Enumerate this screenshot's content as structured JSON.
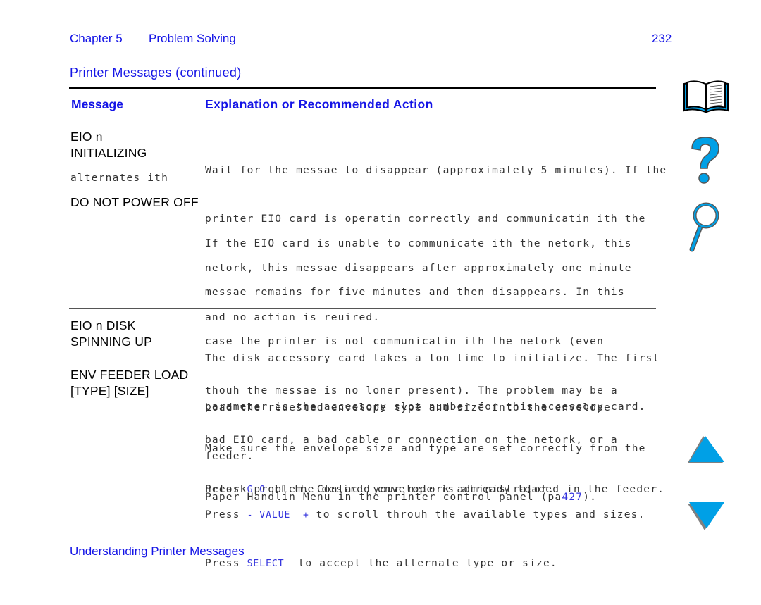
{
  "header": {
    "chapter": "Chapter 5",
    "section": "Problem Solving",
    "page_number": "232"
  },
  "subtitle": "Printer Messages (continued)",
  "table": {
    "columns": [
      "Message",
      "Explanation or Recommended Action"
    ],
    "rows": [
      {
        "message_lines": [
          "EIO n",
          "INITIALIZING"
        ],
        "alternates_label": "alternates ith",
        "message_alt": "DO NOT POWER OFF",
        "paragraphs": [
          [
            "Wait for the messae to disappear (approximately 5 minutes). If the",
            "printer EIO card is operatin correctly and communicatin ith the",
            "netork, this messae disappears after approximately one minute",
            "and no action is reuired."
          ],
          [
            "If the EIO card is unable to communicate ith the netork, this",
            "messae remains for five minutes and then disappears. In this",
            "case the printer is not communicatin ith the netork (even",
            "thouh the messae is no loner present). The problem may be a",
            "bad EIO card, a bad cable or connection on the netork, or a",
            "netork problem. Contact your netork administrator."
          ]
        ]
      },
      {
        "message_lines": [
          "EIO n DISK",
          "SPINNING UP"
        ],
        "paragraphs": [
          [
            "The disk accessory card takes a lon time to initialize. The first",
            "parameter is the accessory slot number for this accessory card."
          ]
        ]
      },
      {
        "message_lines": [
          "ENV FEEDER LOAD",
          "[TYPE] [SIZE]"
        ],
        "paragraphs": [
          [
            "Load the reuested envelope type and size into the envelope",
            "feeder."
          ]
        ],
        "extra": {
          "make_sure_1": "Make sure the envelope size and type are set correctly from the",
          "make_sure_2a": "Paper Handlin Menu in the printer control panel (pa",
          "page_link": "427",
          "make_sure_2b": ").",
          "press_go_a": "Press ",
          "go_key": "G O",
          "press_go_b": " if the desired envelope is already loaded in the feeder.",
          "press_value_a": "Press ",
          "value_key": "- VALUE  +",
          "press_value_b": " to scroll throuh the available types and sizes.",
          "press_select_a": "Press ",
          "select_key": "SELECT",
          "press_select_b": "  to accept the alternate type or size."
        }
      }
    ]
  },
  "footer": "Understanding Printer Messages",
  "icons": {
    "color": "#00a0e6",
    "list": [
      "book-icon",
      "help-question-icon",
      "search-magnifier-icon",
      "previous-page-arrow-icon",
      "next-page-arrow-icon"
    ]
  }
}
